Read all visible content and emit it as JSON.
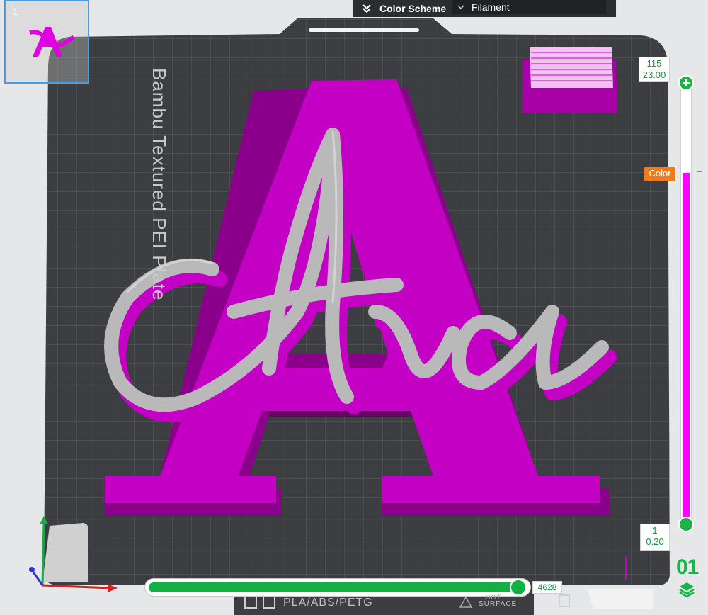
{
  "top_bar": {
    "color_scheme_label": "Color Scheme",
    "selected_scheme": "Filament"
  },
  "plate": {
    "index": "1",
    "name": "Bambu Textured PEI Plate",
    "material_label": "PLA/ABS/PETG",
    "surface_label": "SURFACE",
    "hot_label": "HOT"
  },
  "model": {
    "letter": "A",
    "script_text": "Ava",
    "colors": {
      "letter": "#c400c4",
      "letter_shadow": "#8b008b",
      "script": "#b9b9b9",
      "script_edge": "#d6d6d6"
    }
  },
  "layer_slider": {
    "top_layer": "115",
    "top_height": "23.00",
    "bottom_layer": "1",
    "bottom_height": "0.20",
    "color_tag": "Color",
    "accent": "#1db34a",
    "fill_color": "#ff00ff",
    "tag_color": "#ef7b1c"
  },
  "move_slider": {
    "value": "4628",
    "fill_color": "#10b043"
  },
  "layers_indicator": {
    "text": "01"
  },
  "icons": {
    "chevron": "double-chevron-down-icon",
    "dropdown": "dropdown-arrow-icon",
    "layers": "layers-icon"
  }
}
